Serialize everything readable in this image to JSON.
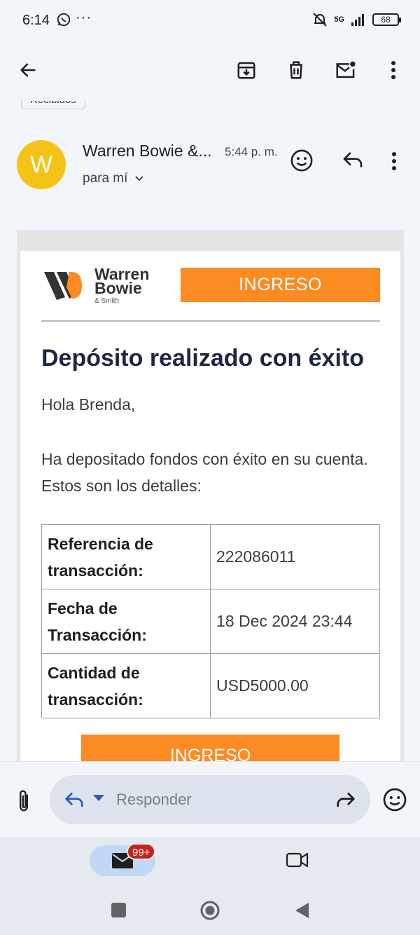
{
  "status_bar": {
    "time": "6:14",
    "more": "···",
    "network": "5G",
    "battery": "68"
  },
  "toolbar": {
    "back_icon": "arrow-left-icon",
    "archive_icon": "archive-icon",
    "delete_icon": "trash-icon",
    "mark_unread_icon": "mail-unread-icon",
    "more_icon": "more-vert-icon"
  },
  "message": {
    "label_chip": "Recibidos",
    "avatar_letter": "W",
    "avatar_color": "#f5c316",
    "sender": "Warren Bowie &...",
    "time": "5:44 p. m.",
    "recipient": "para mí"
  },
  "email": {
    "logo_line1": "Warren",
    "logo_line2": "Bowie",
    "logo_line3": "& Smith",
    "header_button": "INGRESO",
    "title": "Depósito realizado con éxito",
    "greeting": "Hola Brenda,",
    "intro": "Ha depositado fondos con éxito en su cuenta. Estos son los detalles:",
    "rows": [
      {
        "label": "Referencia de transacción:",
        "value": "222086011"
      },
      {
        "label": "Fecha de Transacción:",
        "value": "18 Dec 2024 23:44"
      },
      {
        "label": "Cantidad de transacción:",
        "value": "USD5000.00"
      }
    ],
    "cta_button": "INGRESO",
    "accent_color": "#fd8b24"
  },
  "reply_bar": {
    "placeholder": "Responder"
  },
  "bottom_nav": {
    "mail_badge": "99+"
  }
}
